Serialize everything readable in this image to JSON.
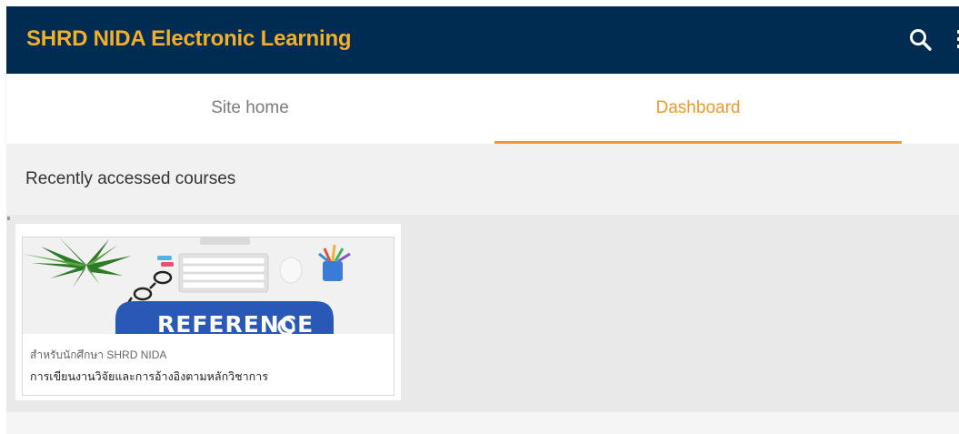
{
  "header": {
    "site_name": "SHRD NIDA Electronic Learning",
    "brand_color": "#f3ae2c",
    "bar_color": "#002c52",
    "search_icon": "search-icon",
    "menu_icon": "kebab-menu-icon"
  },
  "nav": {
    "tabs": [
      {
        "label": "Site home",
        "active": false
      },
      {
        "label": "Dashboard",
        "active": true
      }
    ],
    "active_color": "#ee9a27"
  },
  "main": {
    "section_title": "Recently accessed courses",
    "courses": [
      {
        "image_text": "REFERENCE",
        "category": "สำหรับนักศึกษา SHRD NIDA",
        "name": "การเขียนงานวิจัยและการอ้างอิงตามหลักวิชาการ"
      }
    ]
  }
}
